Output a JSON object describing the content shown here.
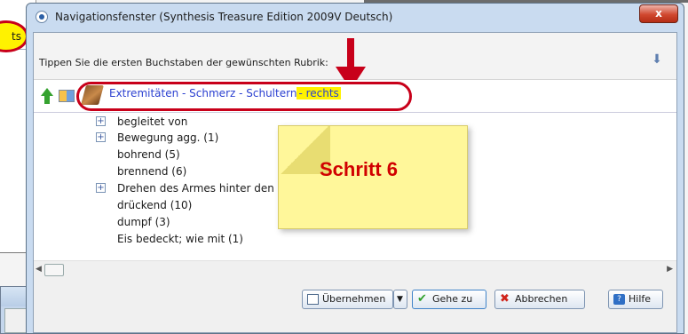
{
  "background": {
    "previous_callout_fragment": "ts"
  },
  "window": {
    "title": "Navigationsfenster (Synthesis Treasure Edition 2009V Deutsch)",
    "close_label": "x"
  },
  "second_window": {
    "close_label": "x"
  },
  "prompt": {
    "text": "Tippen Sie die ersten Buchstaben der gewünschten Rubrik:"
  },
  "path": {
    "main": "Extremitäten - Schmerz - Schultern",
    "highlighted": "- rechts"
  },
  "rubrics": [
    {
      "label": "begleitet von",
      "expandable": true
    },
    {
      "label": "Bewegung agg. (1)",
      "expandable": true
    },
    {
      "label": "bohrend (5)",
      "expandable": false
    },
    {
      "label": "brennend (6)",
      "expandable": false
    },
    {
      "label": "Drehen des Armes hinter den Rü",
      "expandable": true
    },
    {
      "label": "drückend (10)",
      "expandable": false
    },
    {
      "label": "dumpf (3)",
      "expandable": false
    },
    {
      "label": "Eis bedeckt; wie mit (1)",
      "expandable": false
    }
  ],
  "annotation": {
    "step_label": "Schritt 6"
  },
  "buttons": {
    "apply": "Übernehmen",
    "goto": "Gehe zu",
    "cancel": "Abbrechen",
    "help": "Hilfe"
  },
  "colors": {
    "annotation_red": "#c8001a",
    "highlight_yellow": "#fff200",
    "note_yellow": "#fff79a",
    "path_blue": "#2a3fd0"
  }
}
